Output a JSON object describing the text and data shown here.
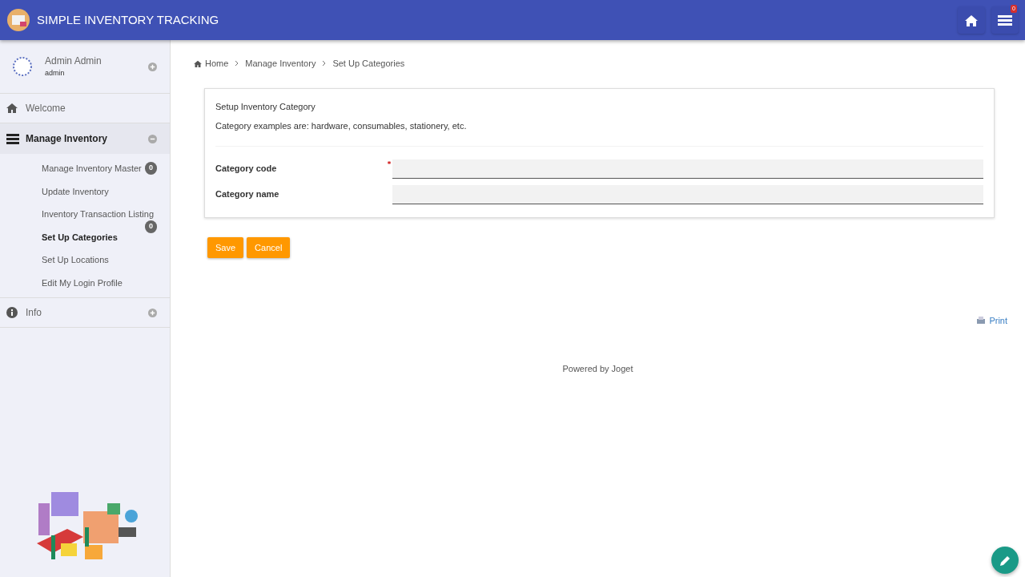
{
  "header": {
    "title": "SIMPLE INVENTORY TRACKING",
    "notification_count": "0"
  },
  "user": {
    "name": "Admin Admin",
    "username": "admin",
    "expanded": false
  },
  "menu": [
    {
      "kind": "link",
      "label": "Welcome"
    },
    {
      "kind": "group",
      "label": "Manage Inventory",
      "expanded": true,
      "children": [
        {
          "label": "Manage Inventory Master",
          "selected": false,
          "badge": "0"
        },
        {
          "label": "Update Inventory",
          "selected": false
        },
        {
          "label": "Inventory Transaction Listing",
          "selected": false,
          "badge": "0"
        },
        {
          "label": "Set Up Categories",
          "selected": true
        },
        {
          "label": "Set Up Locations",
          "selected": false
        },
        {
          "label": "Edit My Login Profile",
          "selected": false
        }
      ]
    },
    {
      "kind": "group",
      "label": "Info",
      "expanded": false
    }
  ],
  "breadcrumb": [
    "Home",
    "Manage Inventory",
    "Set Up Categories"
  ],
  "form": {
    "title": "Setup Inventory Category",
    "description": "Category examples are: hardware, consumables, stationery, etc.",
    "fields": [
      {
        "label": "Category code",
        "required": true
      },
      {
        "label": "Category name",
        "required": false
      }
    ],
    "buttons": [
      "Save",
      "Cancel"
    ]
  },
  "print": "Print",
  "footer": "Powered by Joget"
}
